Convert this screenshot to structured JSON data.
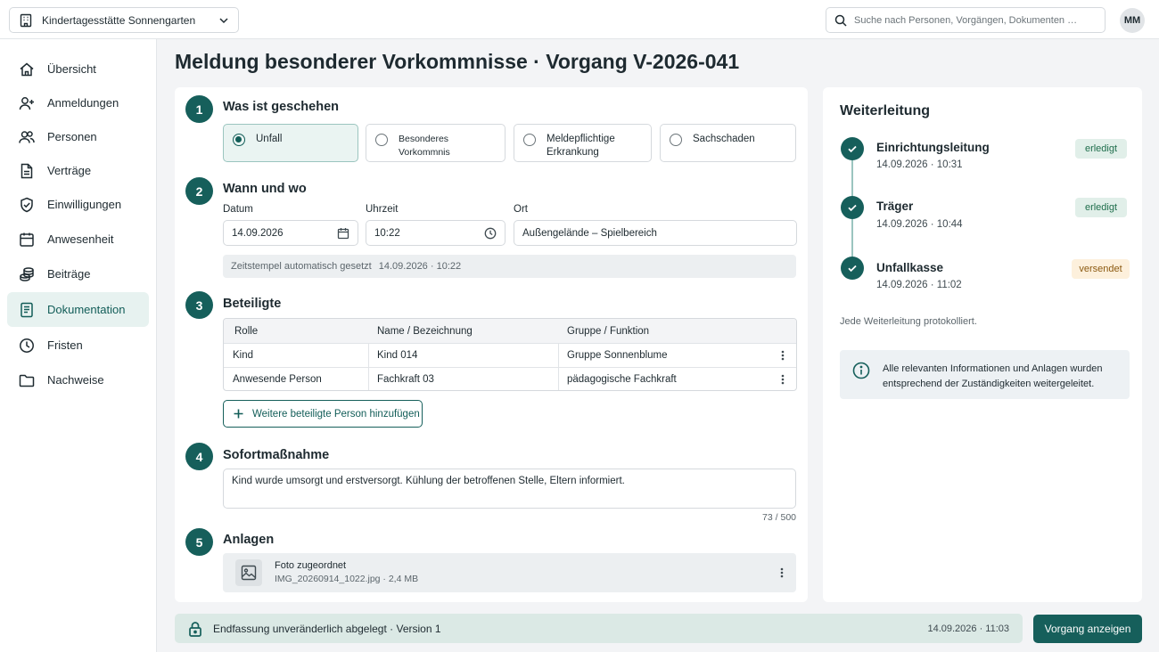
{
  "topbar": {
    "org_name": "Kindertagesstätte Sonnengarten",
    "search_placeholder": "Suche nach Personen, Vorgängen, Dokumenten …",
    "user_initials": "MM"
  },
  "sidebar": {
    "items": [
      {
        "label": "Übersicht",
        "icon": "home-icon"
      },
      {
        "label": "Anmeldungen",
        "icon": "user-plus-icon"
      },
      {
        "label": "Personen",
        "icon": "users-icon"
      },
      {
        "label": "Verträge",
        "icon": "document-icon"
      },
      {
        "label": "Einwilligungen",
        "icon": "shield-check-icon"
      },
      {
        "label": "Anwesenheit",
        "icon": "calendar-icon"
      },
      {
        "label": "Beiträge",
        "icon": "coins-icon"
      },
      {
        "label": "Dokumentation",
        "icon": "notes-icon",
        "active": true
      },
      {
        "label": "Fristen",
        "icon": "clock-icon"
      },
      {
        "label": "Nachweise",
        "icon": "folder-icon"
      }
    ]
  },
  "page": {
    "title": "Meldung besonderer Vorkommnisse · Vorgang V-2026-041"
  },
  "form": {
    "s1": {
      "num": "1",
      "title": "Was ist geschehen",
      "options": [
        "Unfall",
        "Besonderes Vorkommnis",
        "Meldepflichtige Erkrankung",
        "Sachschaden"
      ],
      "selected": "Unfall"
    },
    "s2": {
      "num": "2",
      "title": "Wann und wo",
      "date_label": "Datum",
      "date_value": "14.09.2026",
      "time_label": "Uhrzeit",
      "time_value": "10:22",
      "place_label": "Ort",
      "place_value": "Außengelände – Spielbereich",
      "stamp_label": "Zeitstempel automatisch gesetzt",
      "stamp_value": "14.09.2026 · 10:22"
    },
    "s3": {
      "num": "3",
      "title": "Beteiligte",
      "headers": [
        "Rolle",
        "Name / Bezeichnung",
        "Gruppe / Funktion"
      ],
      "rows": [
        [
          "Kind",
          "Kind 014",
          "Gruppe Sonnenblume"
        ],
        [
          "Anwesende Person",
          "Fachkraft 03",
          "pädagogische Fachkraft"
        ]
      ],
      "add_label": "Weitere beteiligte Person hinzufügen"
    },
    "s4": {
      "num": "4",
      "title": "Sofortmaßnahme",
      "text": "Kind wurde umsorgt und erstversorgt. Kühlung der betroffenen Stelle, Eltern informiert.",
      "counter": "73 / 500"
    },
    "s5": {
      "num": "5",
      "title": "Anlagen",
      "file_title": "Foto zugeordnet",
      "file_meta": "IMG_20260914_1022.jpg · 2,4 MB"
    }
  },
  "forwarding": {
    "title": "Weiterleitung",
    "steps": [
      {
        "name": "Einrichtungsleitung",
        "date": "14.09.2026 · 10:31",
        "status": "erledigt"
      },
      {
        "name": "Träger",
        "date": "14.09.2026 · 10:44",
        "status": "erledigt"
      },
      {
        "name": "Unfallkasse",
        "date": "14.09.2026 · 11:02",
        "status": "versendet"
      }
    ],
    "note": "Jede Weiterleitung protokolliert.",
    "info": "Alle relevanten Informationen und Anlagen wurden entsprechend der Zuständigkeiten weitergeleitet."
  },
  "footer": {
    "status": "Endfassung unveränderlich abgelegt · Version 1",
    "timestamp": "14.09.2026 · 11:03",
    "button": "Vorgang anzeigen"
  },
  "colors": {
    "accent": "#165f5b",
    "accent_light": "#e7f2f0",
    "ok_badge": "#e1efe9",
    "sent_badge": "#fdf0dc"
  }
}
